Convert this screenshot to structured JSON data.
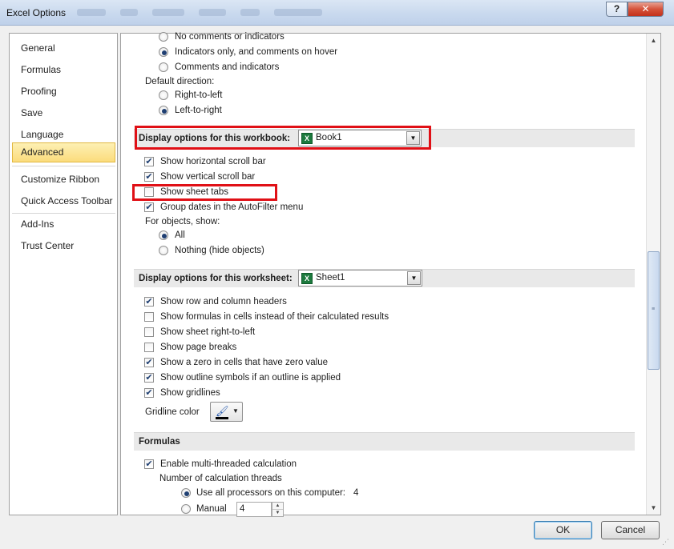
{
  "window": {
    "title": "Excel Options",
    "help_label": "?",
    "close_label": "✕"
  },
  "nav": {
    "items": [
      {
        "label": "General"
      },
      {
        "label": "Formulas"
      },
      {
        "label": "Proofing"
      },
      {
        "label": "Save"
      },
      {
        "label": "Language"
      },
      {
        "label": "Advanced",
        "selected": true
      },
      {
        "label": "Customize Ribbon"
      },
      {
        "label": "Quick Access Toolbar"
      },
      {
        "label": "Add-Ins"
      },
      {
        "label": "Trust Center"
      }
    ]
  },
  "comments": {
    "no_comments": "No comments or indicators",
    "indicators_only": "Indicators only, and comments on hover",
    "comments_and_indicators": "Comments and indicators",
    "selected": "indicators_only"
  },
  "direction": {
    "label": "Default direction:",
    "rtl": "Right-to-left",
    "ltr": "Left-to-right",
    "selected": "ltr"
  },
  "workbook": {
    "section_title": "Display options for this workbook:",
    "selected_value": "Book1",
    "options": [
      {
        "label": "Show horizontal scroll bar",
        "checked": true
      },
      {
        "label": "Show vertical scroll bar",
        "checked": true
      },
      {
        "label": "Show sheet tabs",
        "checked": false
      },
      {
        "label": "Group dates in the AutoFilter menu",
        "checked": true
      }
    ],
    "objects_label": "For objects, show:",
    "objects_all": "All",
    "objects_nothing": "Nothing (hide objects)",
    "objects_selected": "all"
  },
  "worksheet": {
    "section_title": "Display options for this worksheet:",
    "selected_value": "Sheet1",
    "options": [
      {
        "label": "Show row and column headers",
        "checked": true
      },
      {
        "label": "Show formulas in cells instead of their calculated results",
        "checked": false
      },
      {
        "label": "Show sheet right-to-left",
        "checked": false
      },
      {
        "label": "Show page breaks",
        "checked": false
      },
      {
        "label": "Show a zero in cells that have zero value",
        "checked": true
      },
      {
        "label": "Show outline symbols if an outline is applied",
        "checked": true
      },
      {
        "label": "Show gridlines",
        "checked": true
      }
    ],
    "gridline_color_label": "Gridline color"
  },
  "formulas": {
    "section_title": "Formulas",
    "multithreaded_label": "Enable multi-threaded calculation",
    "multithreaded_checked": true,
    "threads_label": "Number of calculation threads",
    "use_all_label": "Use all processors on this computer:",
    "processor_count": "4",
    "manual_label": "Manual",
    "manual_value": "4",
    "selected": "use_all"
  },
  "footer": {
    "ok_label": "OK",
    "cancel_label": "Cancel"
  },
  "icons": {
    "check": "✔",
    "dropdown": "▼",
    "scroll_up": "▲",
    "scroll_down": "▼",
    "excel_workbook": "X",
    "paint_bucket": "🖌",
    "resize_grip": "⋰"
  }
}
